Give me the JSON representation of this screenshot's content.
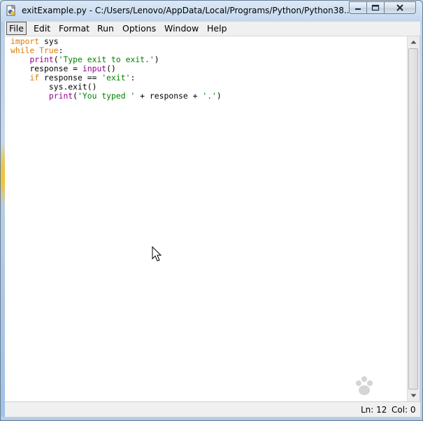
{
  "window": {
    "title": "exitExample.py - C:/Users/Lenovo/AppData/Local/Programs/Python/Python38...",
    "controls": {
      "minimize_icon": "minimize-icon",
      "maximize_icon": "maximize-icon",
      "close_icon": "close-icon"
    }
  },
  "menubar": {
    "items": [
      {
        "label": "File",
        "active": true
      },
      {
        "label": "Edit"
      },
      {
        "label": "Format"
      },
      {
        "label": "Run"
      },
      {
        "label": "Options"
      },
      {
        "label": "Window"
      },
      {
        "label": "Help"
      }
    ]
  },
  "editor": {
    "lines": [
      {
        "indent": "",
        "tokens": [
          {
            "t": "import",
            "c": "kw"
          },
          {
            "t": " sys",
            "c": ""
          }
        ]
      },
      {
        "indent": "",
        "tokens": [
          {
            "t": "while",
            "c": "kw"
          },
          {
            "t": " ",
            "c": ""
          },
          {
            "t": "True",
            "c": "kw"
          },
          {
            "t": ":",
            "c": ""
          }
        ]
      },
      {
        "indent": "    ",
        "tokens": [
          {
            "t": "print",
            "c": "bi"
          },
          {
            "t": "(",
            "c": ""
          },
          {
            "t": "'Type exit to exit.'",
            "c": "str"
          },
          {
            "t": ")",
            "c": ""
          }
        ]
      },
      {
        "indent": "    ",
        "tokens": [
          {
            "t": "response = ",
            "c": ""
          },
          {
            "t": "input",
            "c": "bi"
          },
          {
            "t": "()",
            "c": ""
          }
        ]
      },
      {
        "indent": "    ",
        "tokens": [
          {
            "t": "if",
            "c": "kw"
          },
          {
            "t": " response == ",
            "c": ""
          },
          {
            "t": "'exit'",
            "c": "str"
          },
          {
            "t": ":",
            "c": ""
          }
        ]
      },
      {
        "indent": "        ",
        "tokens": [
          {
            "t": "sys.exit()",
            "c": ""
          }
        ]
      },
      {
        "indent": "        ",
        "tokens": [
          {
            "t": "print",
            "c": "bi"
          },
          {
            "t": "(",
            "c": ""
          },
          {
            "t": "'You typed '",
            "c": "str"
          },
          {
            "t": " + response + ",
            "c": ""
          },
          {
            "t": "'.'",
            "c": "str"
          },
          {
            "t": ")",
            "c": ""
          }
        ]
      }
    ]
  },
  "statusbar": {
    "ln": "Ln: 12",
    "col": "Col: 0"
  },
  "colors": {
    "keyword": "#e07d00",
    "builtin": "#900090",
    "string": "#008000"
  }
}
